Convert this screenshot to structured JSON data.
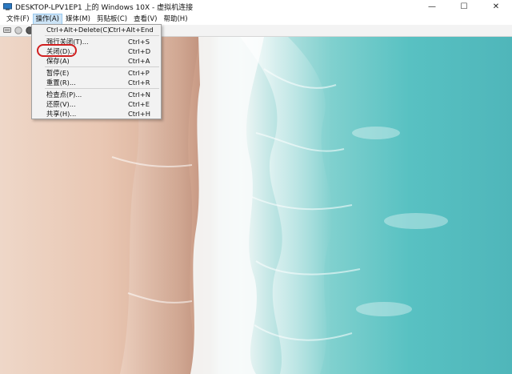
{
  "window": {
    "title": "DESKTOP-LPV1EP1 上的 Windows 10X - 虚拟机连接",
    "minimize_glyph": "—",
    "maximize_glyph": "☐",
    "close_glyph": "✕"
  },
  "menubar": {
    "items": [
      "文件(F)",
      "操作(A)",
      "媒体(M)",
      "剪贴板(C)",
      "查看(V)",
      "帮助(H)"
    ],
    "active_index": 1
  },
  "toolbar": {
    "icons": [
      "ctrl-alt-del-icon",
      "start-icon",
      "turn-off-icon"
    ]
  },
  "action_menu": {
    "items": [
      {
        "label": "Ctrl+Alt+Delete(C)",
        "shortcut": "Ctrl+Alt+End"
      },
      {
        "label": "强行关闭(T)...",
        "shortcut": "Ctrl+S"
      },
      {
        "label": "关闭(D)...",
        "shortcut": "Ctrl+D"
      },
      {
        "label": "保存(A)",
        "shortcut": "Ctrl+A"
      },
      {
        "label": "暂停(E)",
        "shortcut": "Ctrl+P"
      },
      {
        "label": "重置(R)...",
        "shortcut": "Ctrl+R"
      },
      {
        "label": "检查点(P)...",
        "shortcut": "Ctrl+N"
      },
      {
        "label": "还原(V)...",
        "shortcut": "Ctrl+E"
      },
      {
        "label": "共享(H)...",
        "shortcut": "Ctrl+H"
      }
    ],
    "highlighted_item": "关闭(D)...",
    "highlight_color": "#d12020"
  },
  "colors": {
    "sand": "#e9c7b3",
    "wet_sand": "#c89a85",
    "foam": "#f4f8f7",
    "sea": "#58c1c2"
  }
}
